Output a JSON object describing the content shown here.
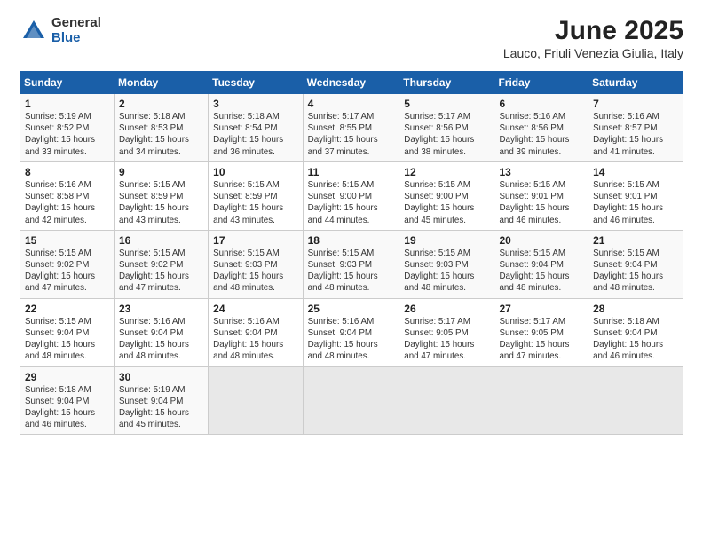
{
  "logo": {
    "general": "General",
    "blue": "Blue"
  },
  "title": "June 2025",
  "subtitle": "Lauco, Friuli Venezia Giulia, Italy",
  "headers": [
    "Sunday",
    "Monday",
    "Tuesday",
    "Wednesday",
    "Thursday",
    "Friday",
    "Saturday"
  ],
  "weeks": [
    [
      {
        "day": "1",
        "info": "Sunrise: 5:19 AM\nSunset: 8:52 PM\nDaylight: 15 hours\nand 33 minutes."
      },
      {
        "day": "2",
        "info": "Sunrise: 5:18 AM\nSunset: 8:53 PM\nDaylight: 15 hours\nand 34 minutes."
      },
      {
        "day": "3",
        "info": "Sunrise: 5:18 AM\nSunset: 8:54 PM\nDaylight: 15 hours\nand 36 minutes."
      },
      {
        "day": "4",
        "info": "Sunrise: 5:17 AM\nSunset: 8:55 PM\nDaylight: 15 hours\nand 37 minutes."
      },
      {
        "day": "5",
        "info": "Sunrise: 5:17 AM\nSunset: 8:56 PM\nDaylight: 15 hours\nand 38 minutes."
      },
      {
        "day": "6",
        "info": "Sunrise: 5:16 AM\nSunset: 8:56 PM\nDaylight: 15 hours\nand 39 minutes."
      },
      {
        "day": "7",
        "info": "Sunrise: 5:16 AM\nSunset: 8:57 PM\nDaylight: 15 hours\nand 41 minutes."
      }
    ],
    [
      {
        "day": "8",
        "info": "Sunrise: 5:16 AM\nSunset: 8:58 PM\nDaylight: 15 hours\nand 42 minutes."
      },
      {
        "day": "9",
        "info": "Sunrise: 5:15 AM\nSunset: 8:59 PM\nDaylight: 15 hours\nand 43 minutes."
      },
      {
        "day": "10",
        "info": "Sunrise: 5:15 AM\nSunset: 8:59 PM\nDaylight: 15 hours\nand 43 minutes."
      },
      {
        "day": "11",
        "info": "Sunrise: 5:15 AM\nSunset: 9:00 PM\nDaylight: 15 hours\nand 44 minutes."
      },
      {
        "day": "12",
        "info": "Sunrise: 5:15 AM\nSunset: 9:00 PM\nDaylight: 15 hours\nand 45 minutes."
      },
      {
        "day": "13",
        "info": "Sunrise: 5:15 AM\nSunset: 9:01 PM\nDaylight: 15 hours\nand 46 minutes."
      },
      {
        "day": "14",
        "info": "Sunrise: 5:15 AM\nSunset: 9:01 PM\nDaylight: 15 hours\nand 46 minutes."
      }
    ],
    [
      {
        "day": "15",
        "info": "Sunrise: 5:15 AM\nSunset: 9:02 PM\nDaylight: 15 hours\nand 47 minutes."
      },
      {
        "day": "16",
        "info": "Sunrise: 5:15 AM\nSunset: 9:02 PM\nDaylight: 15 hours\nand 47 minutes."
      },
      {
        "day": "17",
        "info": "Sunrise: 5:15 AM\nSunset: 9:03 PM\nDaylight: 15 hours\nand 48 minutes."
      },
      {
        "day": "18",
        "info": "Sunrise: 5:15 AM\nSunset: 9:03 PM\nDaylight: 15 hours\nand 48 minutes."
      },
      {
        "day": "19",
        "info": "Sunrise: 5:15 AM\nSunset: 9:03 PM\nDaylight: 15 hours\nand 48 minutes."
      },
      {
        "day": "20",
        "info": "Sunrise: 5:15 AM\nSunset: 9:04 PM\nDaylight: 15 hours\nand 48 minutes."
      },
      {
        "day": "21",
        "info": "Sunrise: 5:15 AM\nSunset: 9:04 PM\nDaylight: 15 hours\nand 48 minutes."
      }
    ],
    [
      {
        "day": "22",
        "info": "Sunrise: 5:15 AM\nSunset: 9:04 PM\nDaylight: 15 hours\nand 48 minutes."
      },
      {
        "day": "23",
        "info": "Sunrise: 5:16 AM\nSunset: 9:04 PM\nDaylight: 15 hours\nand 48 minutes."
      },
      {
        "day": "24",
        "info": "Sunrise: 5:16 AM\nSunset: 9:04 PM\nDaylight: 15 hours\nand 48 minutes."
      },
      {
        "day": "25",
        "info": "Sunrise: 5:16 AM\nSunset: 9:04 PM\nDaylight: 15 hours\nand 48 minutes."
      },
      {
        "day": "26",
        "info": "Sunrise: 5:17 AM\nSunset: 9:05 PM\nDaylight: 15 hours\nand 47 minutes."
      },
      {
        "day": "27",
        "info": "Sunrise: 5:17 AM\nSunset: 9:05 PM\nDaylight: 15 hours\nand 47 minutes."
      },
      {
        "day": "28",
        "info": "Sunrise: 5:18 AM\nSunset: 9:04 PM\nDaylight: 15 hours\nand 46 minutes."
      }
    ],
    [
      {
        "day": "29",
        "info": "Sunrise: 5:18 AM\nSunset: 9:04 PM\nDaylight: 15 hours\nand 46 minutes."
      },
      {
        "day": "30",
        "info": "Sunrise: 5:19 AM\nSunset: 9:04 PM\nDaylight: 15 hours\nand 45 minutes."
      },
      {
        "day": "",
        "info": ""
      },
      {
        "day": "",
        "info": ""
      },
      {
        "day": "",
        "info": ""
      },
      {
        "day": "",
        "info": ""
      },
      {
        "day": "",
        "info": ""
      }
    ]
  ]
}
